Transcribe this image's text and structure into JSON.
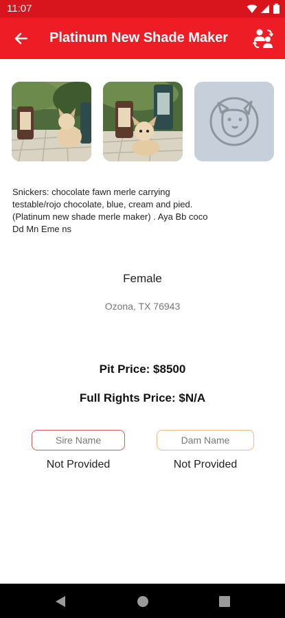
{
  "status_bar": {
    "time": "11:07"
  },
  "app_bar": {
    "title": "Platinum New Shade Maker"
  },
  "photos": [
    {
      "kind": "photo",
      "subject": "French bulldog puppy beside lanterns"
    },
    {
      "kind": "photo",
      "subject": "French bulldog puppy lying on patio"
    },
    {
      "kind": "placeholder",
      "icon": "bulldog-logo-icon"
    }
  ],
  "listing": {
    "description": "Snickers: chocolate fawn merle carrying testable/rojo chocolate, blue, cream and pied. (Platinum new shade merle maker) . Aya Bb coco Dd Mn Eme ns",
    "gender": "Female",
    "location": "Ozona, TX 76943",
    "pit_price": "Pit Price: $8500",
    "full_rights_price": "Full Rights Price: $N/A"
  },
  "parents": {
    "sire_label": "Sire Name",
    "sire_value": "Not Provided",
    "dam_label": "Dam Name",
    "dam_value": "Not Provided"
  },
  "colors": {
    "brand": "#ee1c25",
    "status_bar": "#d8141d",
    "sire_border": "#e0545a",
    "dam_border": "#f0b980"
  }
}
